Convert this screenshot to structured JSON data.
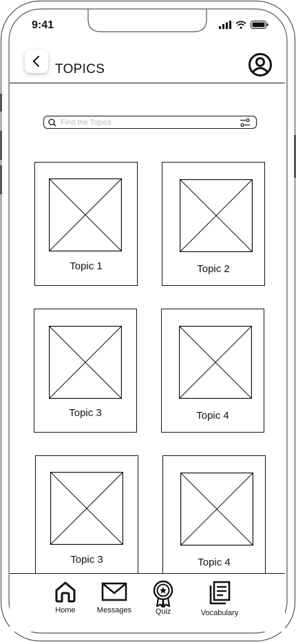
{
  "status_bar": {
    "time": "9:41"
  },
  "header": {
    "title": "TOPICS"
  },
  "search": {
    "placeholder": "Find the Topics"
  },
  "topics": [
    {
      "label": "Topic 1"
    },
    {
      "label": "Topic 2"
    },
    {
      "label": "Topic 3"
    },
    {
      "label": "Topic 4"
    },
    {
      "label": "Topic 3"
    },
    {
      "label": "Topic 4"
    }
  ],
  "tab_bar": {
    "items": [
      {
        "label": "Home",
        "icon": "home-icon",
        "active": true
      },
      {
        "label": "Messages",
        "icon": "mail-icon",
        "active": false
      },
      {
        "label": "Quiz",
        "icon": "award-badge-icon",
        "active": false
      },
      {
        "label": "Vocabulary",
        "icon": "document-list-icon",
        "active": false
      }
    ]
  }
}
